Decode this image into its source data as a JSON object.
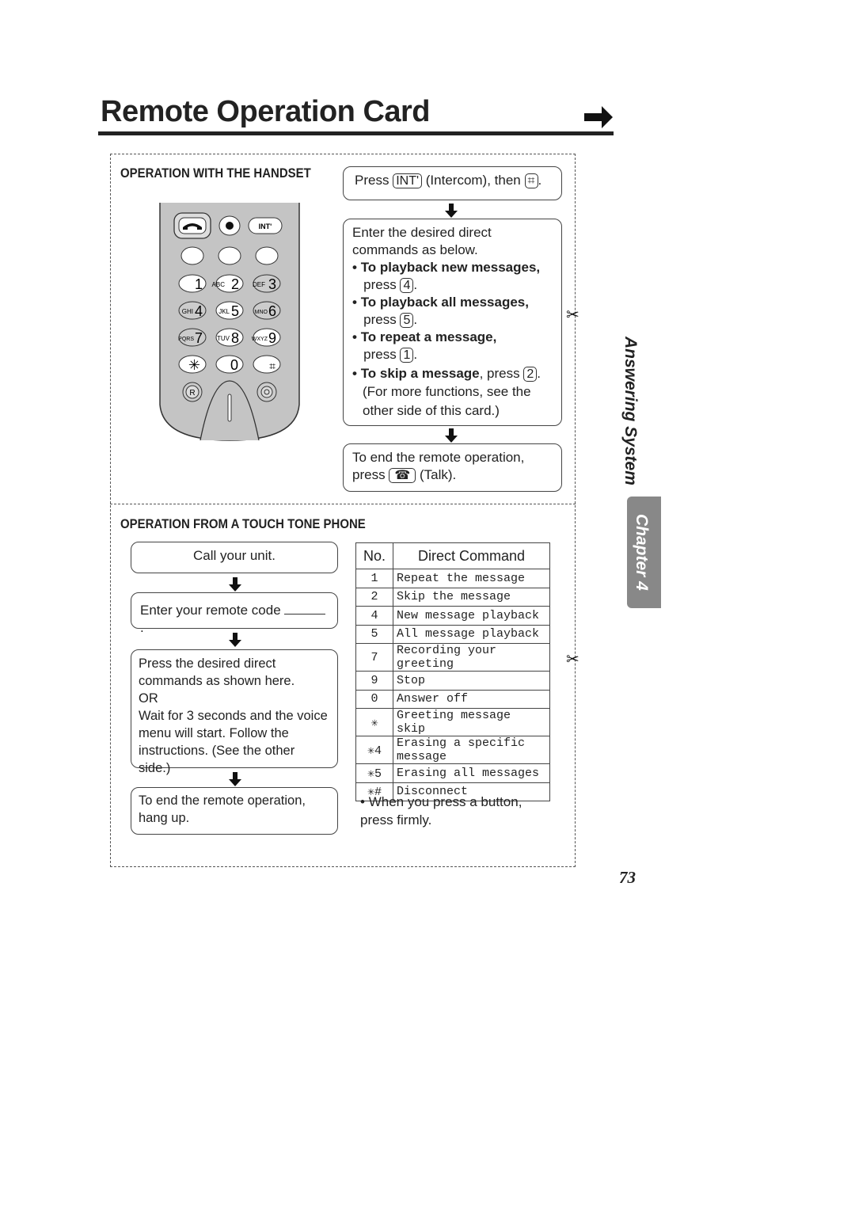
{
  "title": "Remote Operation Card",
  "side_label": "Answering System",
  "chapter": "Chapter 4",
  "page_number": "73",
  "handset": {
    "heading": "OPERATION WITH THE HANDSET",
    "keys": [
      "1",
      "ABC2",
      "DEF3",
      "GHI4",
      "JKL5",
      "MNO6",
      "PQRS7",
      "TUV8",
      "WXYZ9",
      "*",
      "0",
      "#"
    ],
    "int_key": "INT'",
    "r_key": "R",
    "step1": {
      "press": "Press",
      "key": "INT'",
      "mid": "(Intercom), then",
      "end": "."
    },
    "step2": {
      "intro": "Enter the desired direct commands as below.",
      "items": [
        {
          "bold": "To playback new messages,",
          "press": "press",
          "key": "4"
        },
        {
          "bold": "To playback all messages,",
          "press": "press",
          "key": "5"
        },
        {
          "bold": "To repeat a message,",
          "press": "press",
          "key": "1"
        },
        {
          "bold": "To skip a message",
          "press": ", press",
          "key": "2"
        }
      ],
      "note": "(For more functions, see the other side of this card.)"
    },
    "step3": {
      "line1": "To end the remote operation,",
      "press": "press",
      "talk": "(Talk)."
    }
  },
  "touch": {
    "heading": "OPERATION FROM A TOUCH TONE PHONE",
    "steps": [
      "Call your unit.",
      "Enter your remote code",
      "Press the desired direct commands as shown here.",
      "OR",
      "Wait for 3 seconds and the voice menu will start. Follow the instructions. (See the other side.)",
      "To end the remote operation, hang up."
    ],
    "table": {
      "headers": [
        "No.",
        "Direct Command"
      ],
      "rows": [
        [
          "1",
          "Repeat the message"
        ],
        [
          "2",
          "Skip the message"
        ],
        [
          "4",
          "New message playback"
        ],
        [
          "5",
          "All message playback"
        ],
        [
          "7",
          "Recording your greeting"
        ],
        [
          "9",
          "Stop"
        ],
        [
          "0",
          "Answer off"
        ],
        [
          "✳",
          "Greeting message skip"
        ],
        [
          "✳4",
          "Erasing a specific message"
        ],
        [
          "✳5",
          "Erasing all messages"
        ],
        [
          "✳#",
          "Disconnect"
        ]
      ]
    },
    "note": "When you press a button, press firmly."
  }
}
